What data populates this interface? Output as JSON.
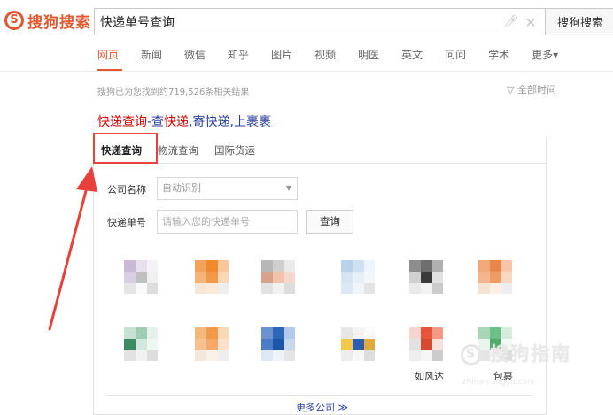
{
  "header": {
    "logo_mark": "S",
    "logo_text": "搜狗搜索",
    "search_value": "快递单号查询",
    "search_button": "搜狗搜索",
    "mic_icon": "microphone-icon",
    "clear_icon": "close-icon"
  },
  "nav": {
    "items": [
      "网页",
      "新闻",
      "微信",
      "知乎",
      "图片",
      "视频",
      "明医",
      "英文",
      "问问",
      "学术",
      "更多▾"
    ],
    "active": "网页"
  },
  "results": {
    "stats": "搜狗已为您找到约719,526条相关结果",
    "time_filter": "全部时间",
    "title_parts": [
      "快递查询",
      "-查",
      "快递",
      ",寄快递,上裹裹"
    ]
  },
  "card": {
    "tabs": [
      "快递查询",
      "物流查询",
      "国际货运"
    ],
    "company_label": "公司名称",
    "company_select": "自动识别",
    "number_label": "快递单号",
    "number_placeholder": "请输入您的快递单号",
    "query_button": "查询",
    "courier_names": [
      "如风达",
      "包裹"
    ],
    "more_link": "更多公司 ≫"
  },
  "watermark": {
    "text": "搜狗指南",
    "url": "zhinan.sogou.com"
  },
  "colors": {
    "brand": "#e4572e",
    "link": "#2a3f9e",
    "annotation": "#e8403a"
  }
}
